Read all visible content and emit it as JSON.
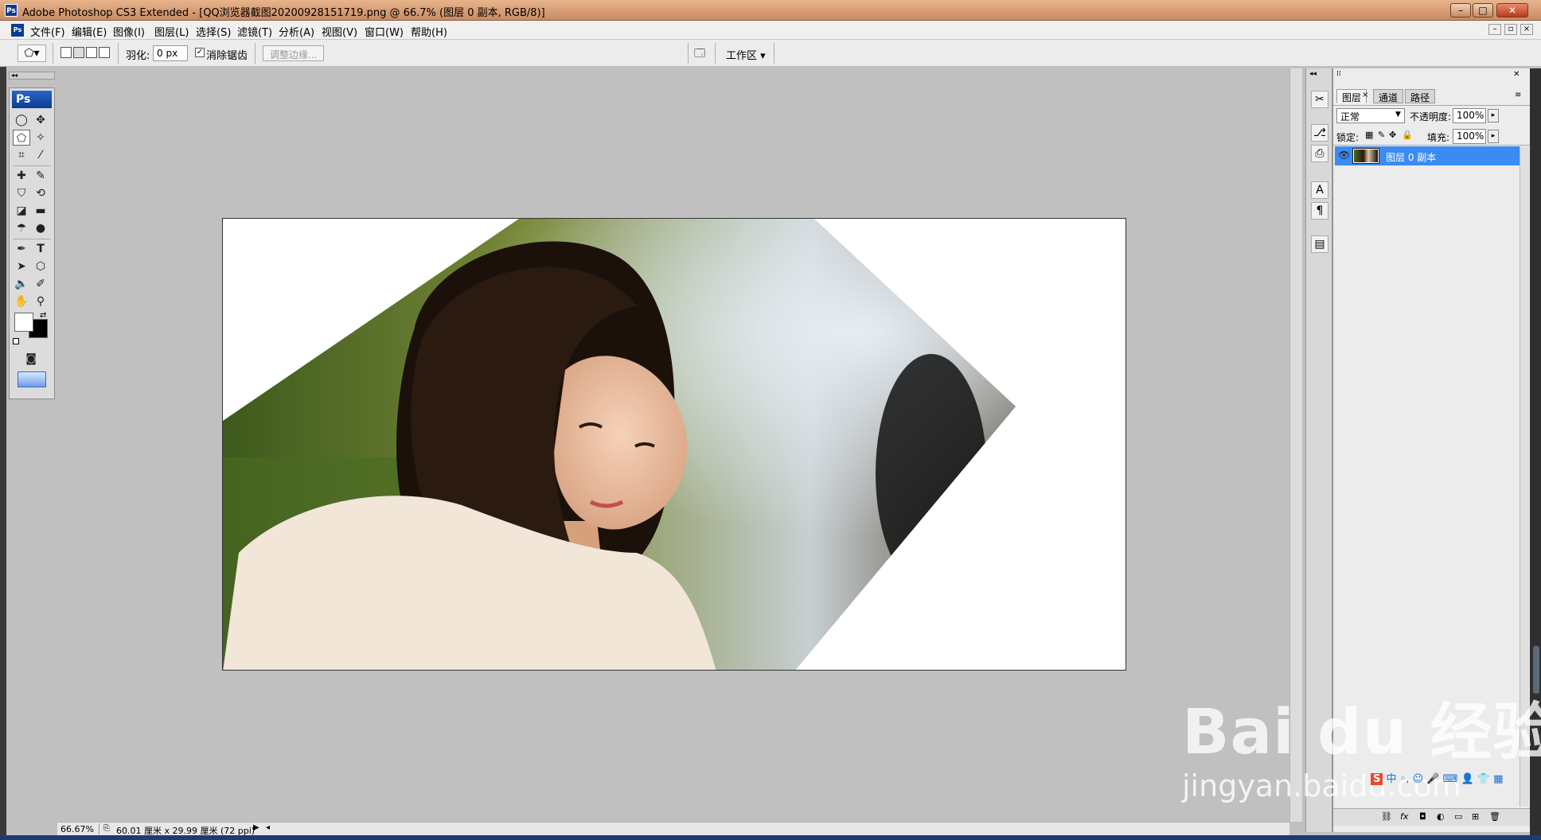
{
  "window": {
    "title": "Adobe Photoshop CS3 Extended - [QQ浏览器截图20200928151719.png @ 66.7% (图层 0 副本, RGB/8)]",
    "app_icon": "Ps"
  },
  "menu": [
    "文件(F)",
    "编辑(E)",
    "图像(I)",
    "图层(L)",
    "选择(S)",
    "滤镜(T)",
    "分析(A)",
    "视图(V)",
    "窗口(W)",
    "帮助(H)"
  ],
  "options": {
    "feather_label": "羽化:",
    "feather_value": "0 px",
    "antialias_label": "消除锯齿",
    "refine_edge": "调整边缘...",
    "workspace": "工作区 ▾"
  },
  "toolbox": {
    "logo": "Ps"
  },
  "status": {
    "zoom": "66.67%",
    "doc_info": "60.01 厘米 x 29.99 厘米 (72 ppi)"
  },
  "layers_panel": {
    "tabs": [
      "图层",
      "通道",
      "路径"
    ],
    "blend_mode": "正常",
    "opacity_label": "不透明度:",
    "opacity_value": "100%",
    "lock_label": "锁定:",
    "fill_label": "填充:",
    "fill_value": "100%",
    "layers": [
      {
        "name": "图层 0 副本",
        "visible": true,
        "selected": true
      }
    ]
  },
  "watermark": {
    "brand": "Bai  du 经验",
    "url": "jingyan.baidu.com"
  },
  "colors": {
    "selection_blue": "#3b8bf0",
    "ps_blue": "#0a3d91",
    "canvas_bg": "#c0c0c0"
  }
}
